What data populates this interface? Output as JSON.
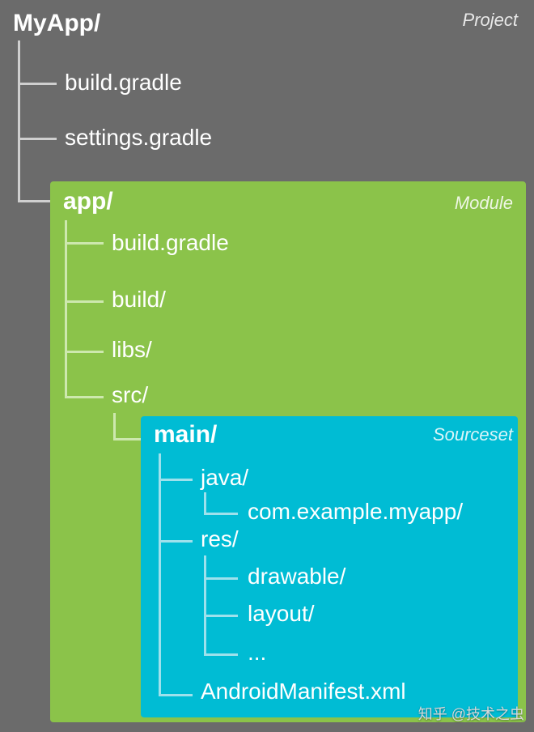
{
  "project": {
    "tag": "Project",
    "root": "MyApp/",
    "children": [
      "build.gradle",
      "settings.gradle"
    ],
    "branch_color": "#cfcfcf"
  },
  "module": {
    "tag": "Module",
    "root": "app/",
    "children": [
      "build.gradle",
      "build/",
      "libs/",
      "src/"
    ],
    "branch_color": "#cde8ae"
  },
  "sourceset": {
    "tag": "Sourceset",
    "root": "main/",
    "children": [
      "java/",
      "res/",
      "AndroidManifest.xml"
    ],
    "java_child": "com.example.myapp/",
    "res_children": [
      "drawable/",
      "layout/",
      "..."
    ],
    "branch_color": "#9ee1ec"
  },
  "watermark": "知乎 @技术之虫"
}
